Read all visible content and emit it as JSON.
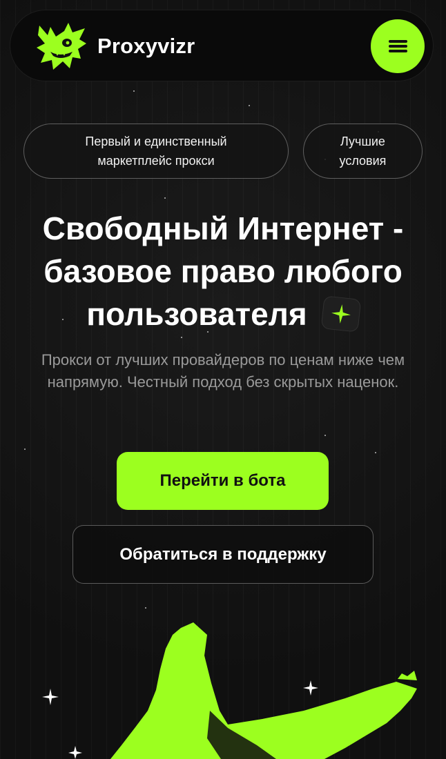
{
  "header": {
    "brand": "Proxyvizr",
    "logo_icon": "green-devil-creature-icon",
    "menu_icon": "hamburger-menu-icon"
  },
  "pills": [
    {
      "label": "Первый и единственный маркетплейс прокси"
    },
    {
      "label": "Лучшие условия"
    }
  ],
  "hero": {
    "headline_line1": "Свободный Интернет -",
    "headline_line2": "базовое право любого",
    "headline_line3": "пользователя",
    "headline_icon": "sparkle-icon",
    "subtitle": "Прокси от лучших провайдеров по ценам ниже чем напрямую. Честный подход без скрытых наценок."
  },
  "actions": {
    "primary_label": "Перейти в бота",
    "secondary_label": "Обратиться в поддержку"
  },
  "colors": {
    "accent": "#9cff1f",
    "background": "#121212",
    "text_muted": "#9a9a9a"
  }
}
